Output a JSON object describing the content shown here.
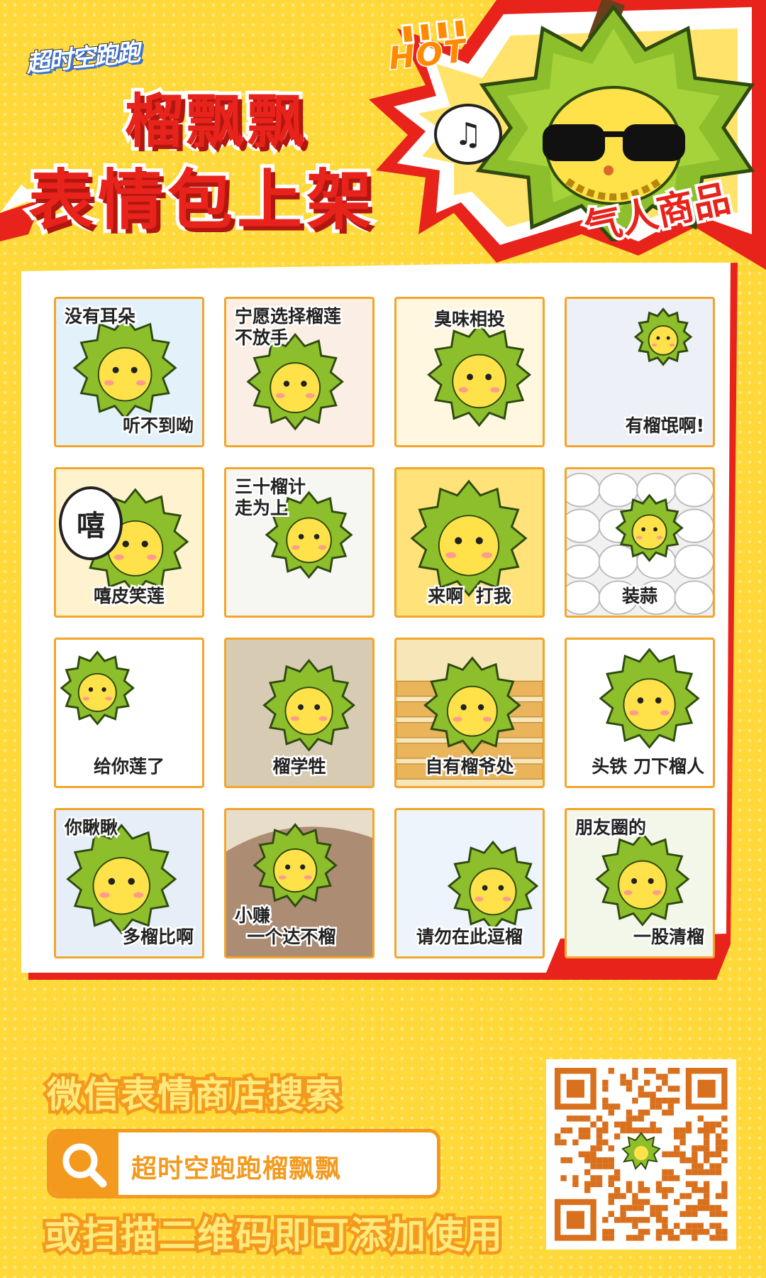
{
  "logo": {
    "text": "超时空跑跑"
  },
  "hot_badge": "HOT",
  "title": {
    "line1": "榴飘飘",
    "line2": "表情包上架"
  },
  "promo_label": "气人商品",
  "music_note": "♫",
  "stickers": [
    {
      "caption": "没有耳朵",
      "caption2": "听不到呦",
      "bg": "#e3f1fb"
    },
    {
      "caption": "宁愿选择榴莲\n不放手",
      "bg": "#fbeee4"
    },
    {
      "caption": "臭味相投",
      "bg": "#fff7e0"
    },
    {
      "caption": "有榴氓啊!",
      "bg": "#eef0f7"
    },
    {
      "caption": "嘻皮笑莲",
      "bubble": "嘻",
      "bg": "#fff3cf"
    },
    {
      "caption": "三十榴计\n走为上",
      "bg": "#f6f7f2"
    },
    {
      "caption": "来啊  打我",
      "bg": "#ffe27a"
    },
    {
      "caption": "装蒜",
      "bg": "#f1f1f1"
    },
    {
      "caption": "给你莲了",
      "bg": "#ffffff"
    },
    {
      "caption": "榴学牲",
      "bg": "#d8cbb4"
    },
    {
      "caption": "自有榴爷处",
      "bg": "#f7e6b8"
    },
    {
      "caption": "头铁 刀下榴人",
      "bg": "#ffffff"
    },
    {
      "caption": "你瞅瞅",
      "caption2": "多榴比啊",
      "bg": "#e6eef8"
    },
    {
      "caption": "小赚\n  一个达不榴",
      "bg": "#e8dccb"
    },
    {
      "caption": "请勿在此逗榴",
      "bg": "#eef4fb"
    },
    {
      "caption": "朋友圈的",
      "caption2": "一股清榴",
      "bg": "#f3f7e9"
    }
  ],
  "cta": {
    "line1": "微信表情商店搜索",
    "search_text": "超时空跑跑榴飘飘",
    "line2": "或扫描二维码即可添加使用"
  },
  "colors": {
    "bg": "#ffd93a",
    "red": "#e8231b",
    "orange": "#f39a1e",
    "durian": "#8dbe2c"
  }
}
